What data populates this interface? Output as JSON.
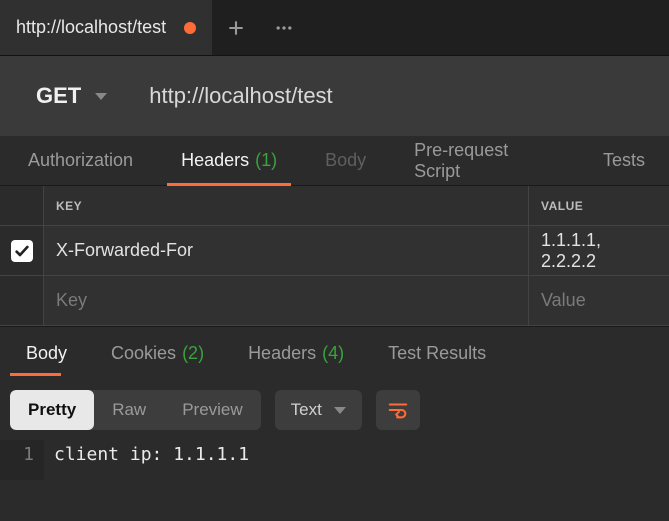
{
  "tab": {
    "title": "http://localhost/test",
    "dirty": true
  },
  "request": {
    "method": "GET",
    "url": "http://localhost/test",
    "subtabs": {
      "authorization": "Authorization",
      "headers": "Headers",
      "headers_count": "(1)",
      "body": "Body",
      "prerequest": "Pre-request Script",
      "tests": "Tests"
    },
    "headers_table": {
      "col_key": "KEY",
      "col_value": "VALUE",
      "rows": [
        {
          "checked": true,
          "key": "X-Forwarded-For",
          "value": "1.1.1.1, 2.2.2.2"
        }
      ],
      "placeholder_key": "Key",
      "placeholder_value": "Value"
    }
  },
  "response": {
    "subtabs": {
      "body": "Body",
      "cookies": "Cookies",
      "cookies_count": "(2)",
      "headers": "Headers",
      "headers_count": "(4)",
      "test_results": "Test Results"
    },
    "view": {
      "pretty": "Pretty",
      "raw": "Raw",
      "preview": "Preview",
      "format": "Text"
    },
    "body_lines": [
      "client ip: 1.1.1.1"
    ]
  }
}
